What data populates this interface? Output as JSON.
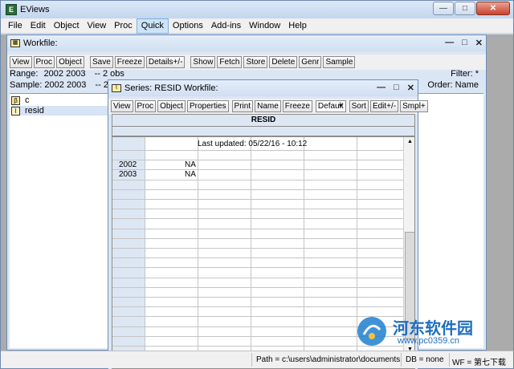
{
  "app": {
    "title": "EViews",
    "icon": "eviews-icon"
  },
  "window_controls": {
    "minimize": "—",
    "maximize": "□",
    "close": "✕"
  },
  "menu": [
    "File",
    "Edit",
    "Object",
    "View",
    "Proc",
    "Quick",
    "Options",
    "Add-ins",
    "Window",
    "Help"
  ],
  "menu_active": "Quick",
  "workfile": {
    "title": "Workfile:",
    "toolbar": [
      "View",
      "Proc",
      "Object",
      "Save",
      "Freeze",
      "Details+/-",
      "Show",
      "Fetch",
      "Store",
      "Delete",
      "Genr",
      "Sample"
    ],
    "range_label": "Range:",
    "range_value": "2002 2003",
    "range_obs": "--  2 obs",
    "filter": "Filter: *",
    "sample_label": "Sample:",
    "sample_value": "2002 2003",
    "sample_dash": "--  2",
    "order": "Order: Name",
    "objects": [
      {
        "name": "c",
        "icon": "coef-icon"
      },
      {
        "name": "resid",
        "icon": "series-icon"
      }
    ]
  },
  "series": {
    "title": "Series: RESID   Workfile:",
    "toolbar": [
      "View",
      "Proc",
      "Object",
      "Properties",
      "Print",
      "Name",
      "Freeze"
    ],
    "dropdown_value": "Default",
    "toolbar2": [
      "Sort",
      "Edit+/-",
      "Smpl+"
    ],
    "header": "RESID",
    "last_updated": "Last updated: 05/22/16 - 10:12",
    "rows": [
      {
        "label": "2002",
        "value": "NA"
      },
      {
        "label": "2003",
        "value": "NA"
      }
    ]
  },
  "status": {
    "path": "Path = c:\\users\\administrator\\documents",
    "db": "DB = none",
    "wf": "WF = 第七下载"
  },
  "watermark": {
    "text": "河东软件园",
    "url": "www.pc0359.cn"
  },
  "colors": {
    "frame": "#c9daf0",
    "mdi": "#ababab",
    "title_gradient": "#dce8f7"
  }
}
